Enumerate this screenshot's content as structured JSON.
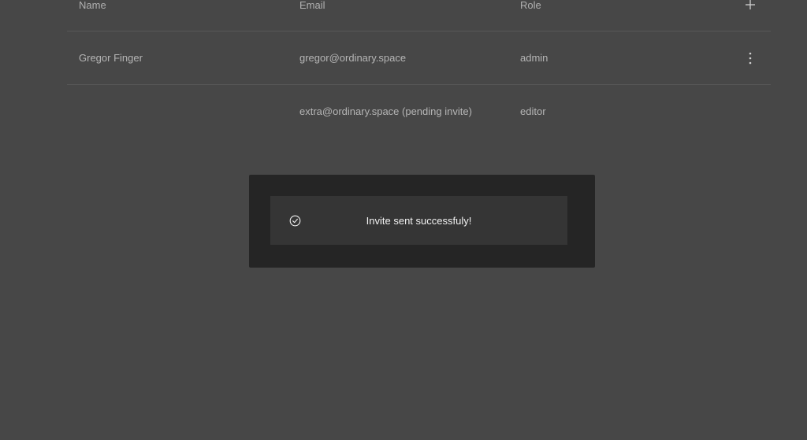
{
  "table": {
    "headers": {
      "name": "Name",
      "email": "Email",
      "role": "Role"
    },
    "add_icon": "plus-icon",
    "more_icon": "kebab-vertical-icon",
    "rows": [
      {
        "name": "Gregor Finger",
        "email": "gregor@ordinary.space",
        "role": "admin"
      },
      {
        "name": "",
        "email": "extra@ordinary.space (pending invite)",
        "role": "editor"
      }
    ]
  },
  "toast": {
    "icon": "check-circle-icon",
    "message": "Invite sent successfuly!"
  },
  "colors": {
    "background": "#474747",
    "toast_backdrop": "#252525",
    "toast": "#353535",
    "divider": "#575757"
  }
}
